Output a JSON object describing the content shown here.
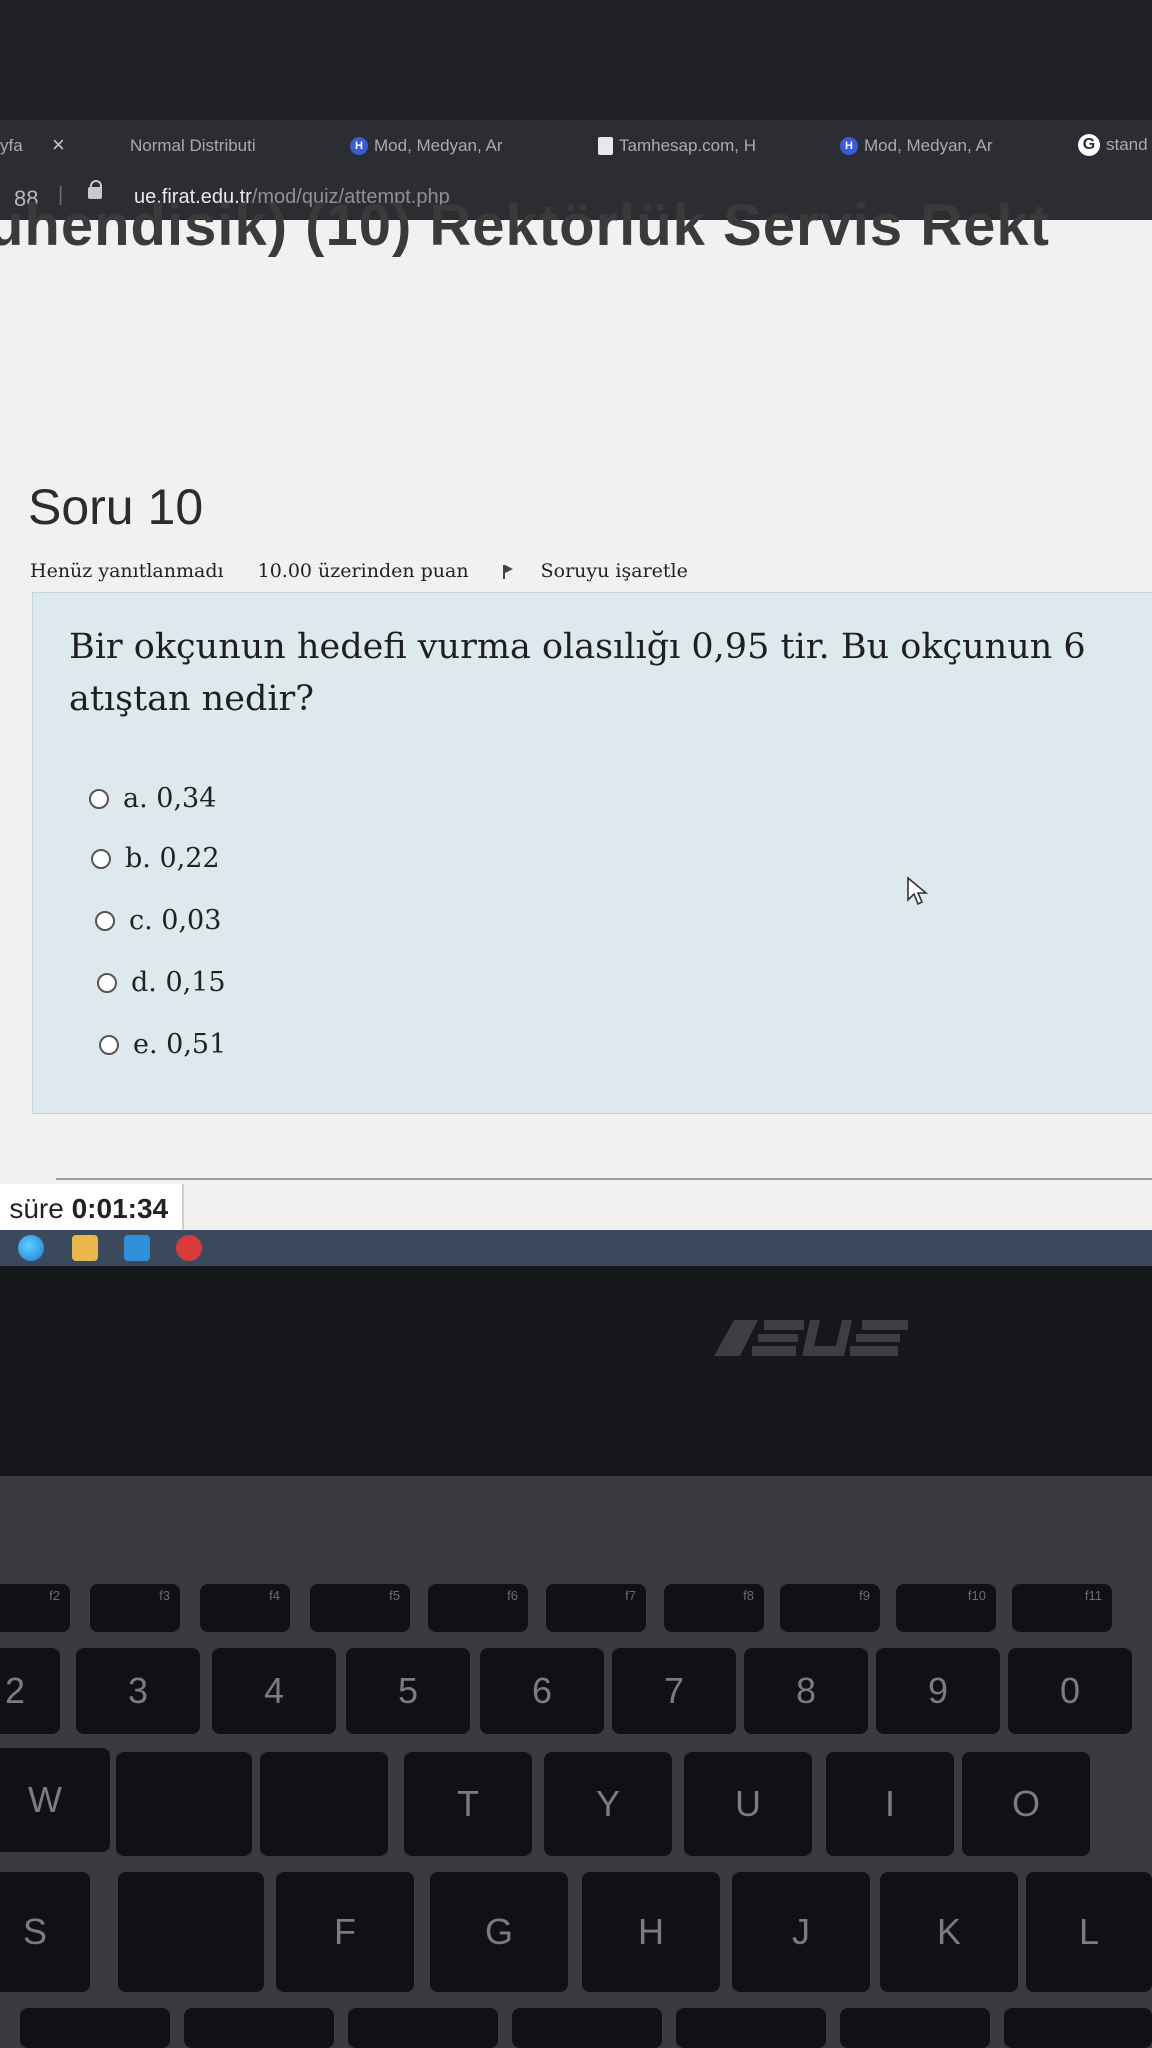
{
  "browser": {
    "tabs": [
      {
        "label": "yfa",
        "icon": "none"
      },
      {
        "label": "Normal Distributi",
        "icon": "none"
      },
      {
        "label": "Mod, Medyan, Ar",
        "icon": "h-icon"
      },
      {
        "label": "Tamhesap.com, H",
        "icon": "doc-icon"
      },
      {
        "label": "Mod, Medyan, Ar",
        "icon": "h-icon"
      },
      {
        "label": "stand",
        "icon": "g-icon"
      }
    ],
    "tab_close": "×",
    "url_host": "ue.firat.edu.tr",
    "url_path": "/mod/quiz/attempt.php",
    "address_prefix": "88 |"
  },
  "page": {
    "course_title": "uhendisik) (10) Rektörlük Servis Rekt",
    "question_number": "Soru 10",
    "status": "Henüz yanıtlanmadı",
    "points": "10.00 üzerinden puan",
    "flag_label": "Soruyu işaretle",
    "question_text": "Bir okçunun hedefi vurma olasılığı 0,95 tir. Bu okçunun 6 atıştan nedir?",
    "answers": [
      {
        "label": "a. 0,34"
      },
      {
        "label": "b. 0,22"
      },
      {
        "label": "c. 0,03"
      },
      {
        "label": "d. 0,15"
      },
      {
        "label": "e. 0,51"
      }
    ],
    "timer_prefix": "n süre",
    "timer_value": "0:01:34"
  },
  "taskbar": {
    "icons": [
      "edge-icon",
      "folder-icon",
      "mail-icon",
      "opera-icon"
    ]
  },
  "laptop": {
    "brand": "ASUS",
    "fn_keys": [
      "f2",
      "f3",
      "f4",
      "f5",
      "f6",
      "f7",
      "f8",
      "f9",
      "f10",
      "f11"
    ],
    "number_keys": [
      "2",
      "3",
      "4",
      "5",
      "6",
      "7",
      "8",
      "9",
      "0"
    ],
    "letter_row_1": [
      "W",
      "T",
      "Y",
      "U",
      "I",
      "O"
    ],
    "letter_row_2": [
      "S",
      "F",
      "G",
      "H",
      "J",
      "K",
      "L"
    ]
  },
  "colors": {
    "question_bg": "#dde9ec",
    "page_bg": "#f1f1ef",
    "tab_bg": "#2b2d33",
    "taskbar_bg": "#3a4a5c"
  }
}
